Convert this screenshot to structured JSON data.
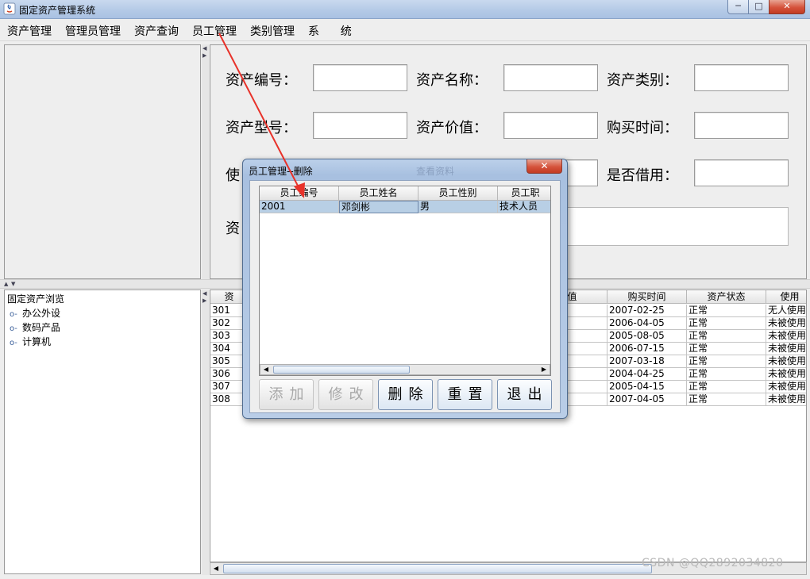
{
  "window": {
    "title": "固定资产管理系统",
    "minimize_glyph": "─",
    "maximize_glyph": "□",
    "close_glyph": "✕"
  },
  "menubar": {
    "items": [
      "资产管理",
      "管理员管理",
      "资产查询",
      "员工管理",
      "类别管理",
      "系      统"
    ]
  },
  "form": {
    "asset_no_label": "资产编号：",
    "asset_name_label": "资产名称：",
    "asset_category_label": "资产类别：",
    "asset_model_label": "资产型号：",
    "asset_value_label": "资产价值：",
    "purchase_time_label": "购买时间：",
    "use_label_partial": "使",
    "borrowed_label": "是否借用：",
    "remark_label_partial": "资"
  },
  "tree": {
    "root": "固定资产浏览",
    "nodes": [
      "办公外设",
      "数码产品",
      "计算机"
    ]
  },
  "asset_table": {
    "headers": [
      "资",
      "价值",
      "购买时间",
      "资产状态",
      "使用"
    ],
    "rows": [
      {
        "id": "301",
        "date": "2007-02-25",
        "status": "正常",
        "usage": "无人使用"
      },
      {
        "id": "302",
        "date": "2006-04-05",
        "status": "正常",
        "usage": "未被使用"
      },
      {
        "id": "303",
        "date": "2005-08-05",
        "status": "正常",
        "usage": "未被使用"
      },
      {
        "id": "304",
        "date": "2006-07-15",
        "status": "正常",
        "usage": "未被使用"
      },
      {
        "id": "305",
        "date": "2007-03-18",
        "status": "正常",
        "usage": "未被使用"
      },
      {
        "id": "306",
        "date": "2004-04-25",
        "status": "正常",
        "usage": "未被使用"
      },
      {
        "id": "307",
        "date": "2005-04-15",
        "status": "正常",
        "usage": "未被使用"
      },
      {
        "id": "308",
        "date": "2007-04-05",
        "status": "正常",
        "usage": "未被使用"
      }
    ]
  },
  "dialog": {
    "title": "员工管理--删除",
    "close_glyph": "✕",
    "ghost_title": "查看资料",
    "headers": [
      "员工编号",
      "员工姓名",
      "员工性别",
      "员工职"
    ],
    "rows": [
      {
        "id": "2001",
        "name": "邓剑彬",
        "gender": "男",
        "job": "技术人员"
      }
    ],
    "buttons": {
      "add": "添加",
      "edit": "修改",
      "delete": "删除",
      "reset": "重置",
      "exit": "退出"
    }
  },
  "watermark": "CSDN @QQ2892034820",
  "colors": {
    "selection": "#b8cfe5",
    "annotation_arrow": "#e8322a",
    "titlebar": "#b3c9e6"
  }
}
